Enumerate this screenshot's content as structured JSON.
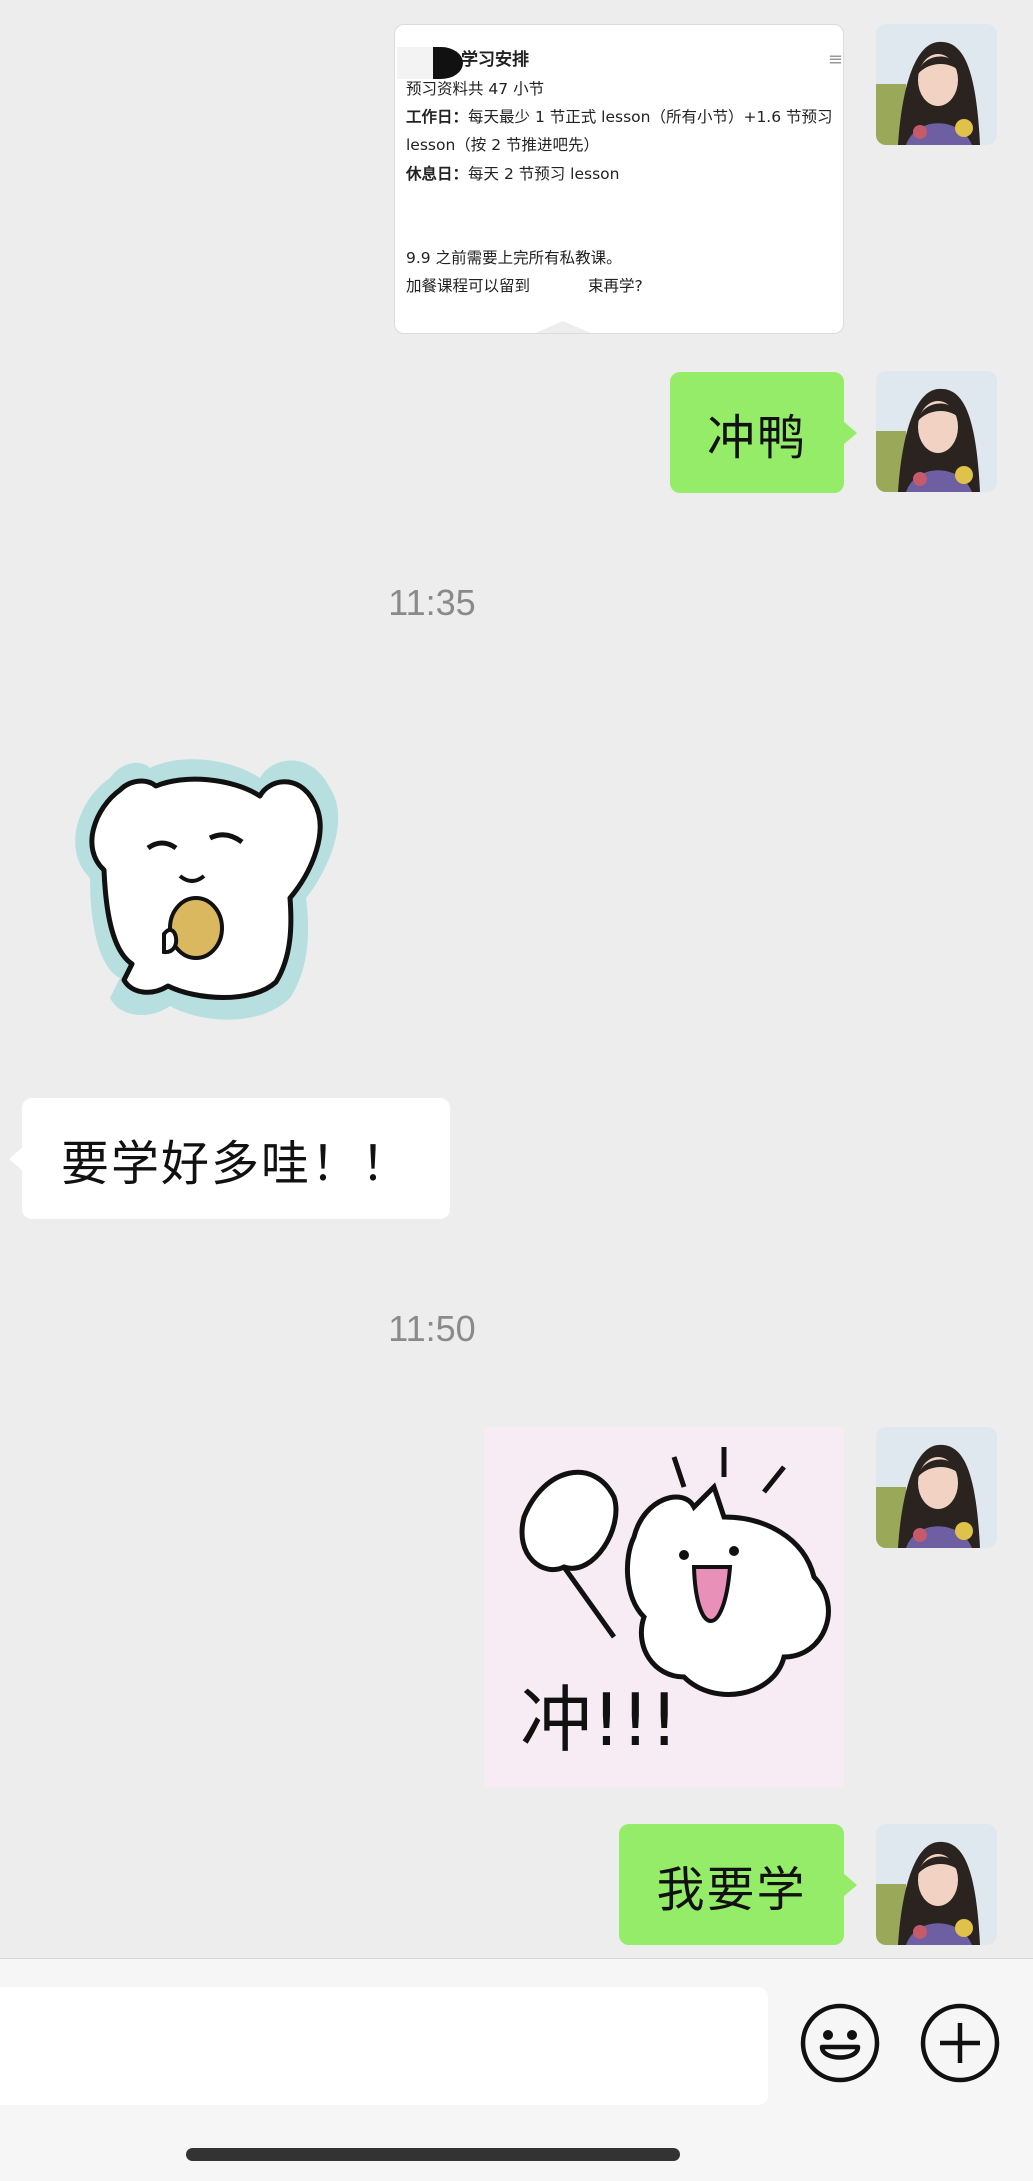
{
  "document_card": {
    "title": "学习安排",
    "menu_icon": "menu-lines-icon",
    "line1": "预习资料共 47 小节",
    "line2_label": "工作日：",
    "line2_text": "每天最少 1 节正式 lesson（所有小节）+1.6 节预习",
    "line3_text": "lesson（按 2 节推进吧先）",
    "line4_label": "休息日：",
    "line4_text": "每天 2 节预习 lesson",
    "line5_text": "9.9 之前需要上完所有私教课。",
    "line6_text_a": "加餐课程可以留到",
    "line6_text_b": "束再学?"
  },
  "messages": {
    "msg1_text": "冲鸭",
    "time1": "11:35",
    "msg2_text": "要学好多哇！！",
    "time2": "11:50",
    "sticker2_text": "冲!!!",
    "msg3_text": "我要学"
  },
  "input_bar": {
    "emoji_icon": "smiley-face-icon",
    "plus_icon": "plus-circle-icon"
  },
  "colors": {
    "background": "#ededed",
    "green_bubble": "#95ec69",
    "white_bubble": "#ffffff",
    "timestamp": "#8a8a8a"
  }
}
